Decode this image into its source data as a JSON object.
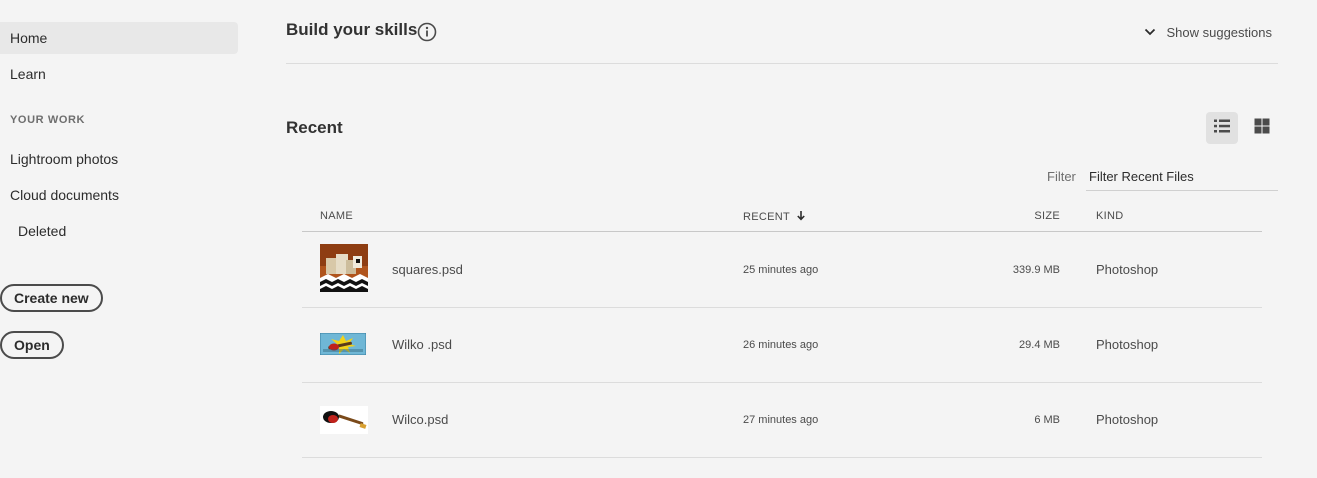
{
  "sidebar": {
    "home": "Home",
    "learn": "Learn",
    "section_label": "YOUR WORK",
    "lightroom": "Lightroom photos",
    "cloud_docs": "Cloud documents",
    "deleted": "Deleted",
    "create_new": "Create new",
    "open": "Open"
  },
  "skills": {
    "title": "Build your skills",
    "show_suggestions": "Show suggestions"
  },
  "recent": {
    "title": "Recent",
    "filter_label": "Filter",
    "filter_placeholder": "Filter Recent Files",
    "view_modes": [
      "list-view-icon",
      "grid-view-icon"
    ],
    "columns": {
      "name": "NAME",
      "recent": "RECENT",
      "size": "SIZE",
      "kind": "KIND"
    },
    "files": [
      {
        "name": "squares.psd",
        "time": "25 minutes ago",
        "size": "339.9 MB",
        "kind": "Photoshop"
      },
      {
        "name": "Wilko .psd",
        "time": "26 minutes ago",
        "size": "29.4 MB",
        "kind": "Photoshop"
      },
      {
        "name": "Wilco.psd",
        "time": "27 minutes ago",
        "size": "6 MB",
        "kind": "Photoshop"
      }
    ]
  },
  "colors": {
    "background": "#f4f4f4",
    "active_nav": "#e8e8e8",
    "text": "#2c2c2c"
  }
}
